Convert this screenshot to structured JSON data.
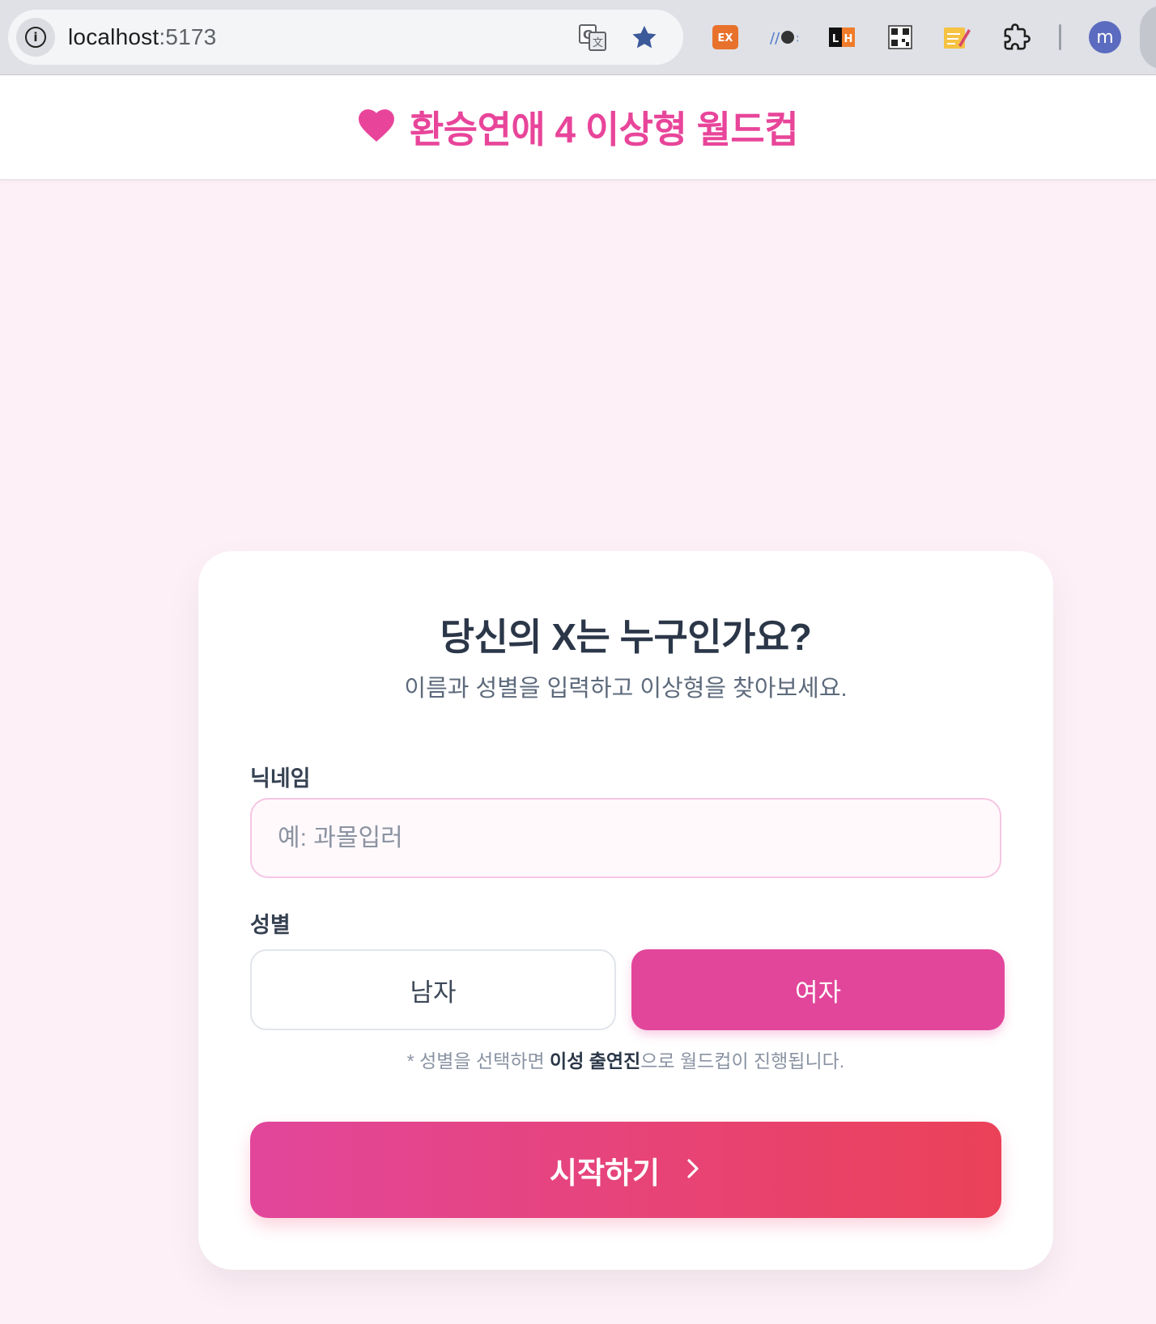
{
  "browser": {
    "url_host": "localhost",
    "url_port": ":5173",
    "icons": [
      "info-icon",
      "translate-icon",
      "bookmark-star-icon"
    ],
    "extensions": [
      "ex-extension-icon",
      "github-extension-icon",
      "lighthouse-extension-icon",
      "qr-code-extension-icon",
      "notes-extension-icon",
      "extensions-puzzle-icon"
    ],
    "ex_label": "EX",
    "lh_label_l": "L",
    "lh_label_h": "H",
    "profile_initial": "m"
  },
  "header": {
    "title": "환승연애 4 이상형 월드컵",
    "icon": "heart-icon",
    "accent_color": "#e8459a"
  },
  "card": {
    "title": "당신의 X는 누구인가요?",
    "subtitle": "이름과 성별을 입력하고 이상형을 찾아보세요.",
    "nickname_label": "닉네임",
    "nickname_placeholder": "예: 과몰입러",
    "nickname_value": "",
    "gender_label": "성별",
    "gender_options": [
      "남자",
      "여자"
    ],
    "gender_selected": "여자",
    "hint_prefix": "* 성별을 선택하면 ",
    "hint_bold": "이성 출연진",
    "hint_suffix": "으로 월드컵이 진행됩니다.",
    "start_label": "시작하기",
    "start_icon": "chevron-right-icon"
  },
  "colors": {
    "page_bg": "#fdf1f7",
    "primary": "#e2469b",
    "gradient_end": "#eb4158"
  }
}
